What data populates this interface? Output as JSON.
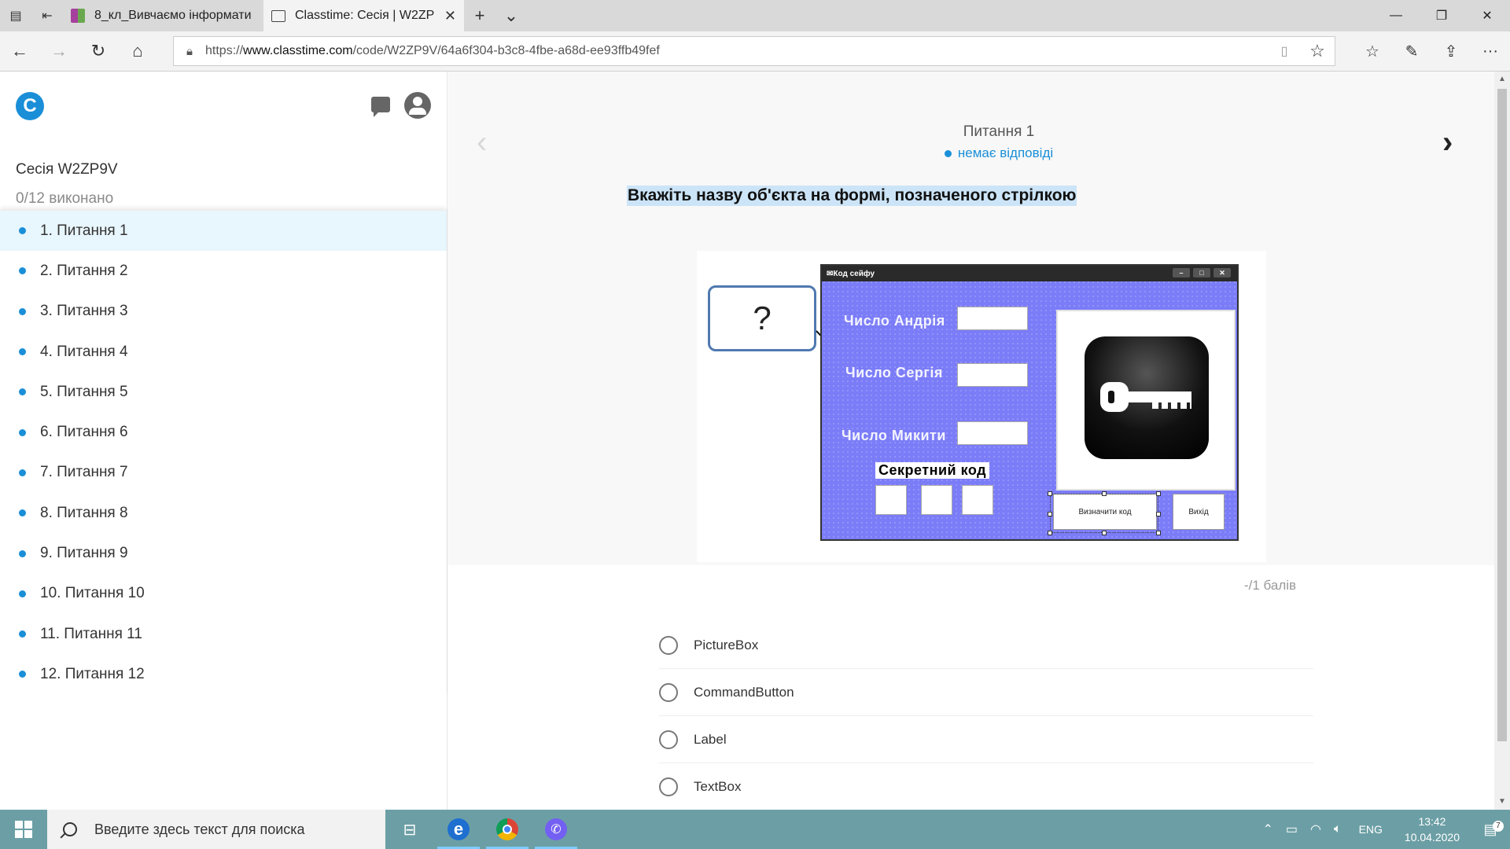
{
  "browser": {
    "tabs": [
      {
        "title": "8_кл_Вивчаємо інформати"
      },
      {
        "title": "Classtime: Сесія | W2ZP"
      }
    ],
    "url_prefix": "https://",
    "url_domain": "www.classtime.com",
    "url_path": "/code/W2ZP9V/64a6f304-b3c8-4fbe-a68d-ee93ffb49fef"
  },
  "sidebar": {
    "logo": "C",
    "session_title": "Сесія W2ZP9V",
    "progress": "0/12 виконано",
    "questions": [
      "1. Питання 1",
      "2. Питання 2",
      "3. Питання 3",
      "4. Питання 4",
      "5. Питання 5",
      "6. Питання 6",
      "7. Питання 7",
      "8. Питання 8",
      "9. Питання 9",
      "10. Питання 10",
      "11. Питання 11",
      "12. Питання 12"
    ],
    "active_index": 0
  },
  "question": {
    "label": "Питання 1",
    "status": "немає відповіді",
    "text": "Вкажіть назву об'єкта на формі, позначеного стрілкою",
    "points": "-/1 балів",
    "answers": [
      "PictureBox",
      "CommandButton",
      "Label",
      "TextBox"
    ]
  },
  "figure": {
    "question_mark": "?",
    "form_title": "Код сейфу",
    "labels": [
      "Число Андрія",
      "Число Сергія",
      "Число Микити"
    ],
    "secret_label": "Секретний код",
    "btn_compute": "Визначити код",
    "btn_exit": "Вихід",
    "form_color": "#7b7cf7"
  },
  "taskbar": {
    "search_placeholder": "Введите здесь текст для поиска",
    "lang": "ENG",
    "time": "13:42",
    "date": "10.04.2020",
    "notifications": "7"
  },
  "colors": {
    "accent": "#1a8fd8",
    "active_row": "#e8f6fd",
    "selection": "#cce4f7",
    "taskbar": "#6c9fa5"
  }
}
